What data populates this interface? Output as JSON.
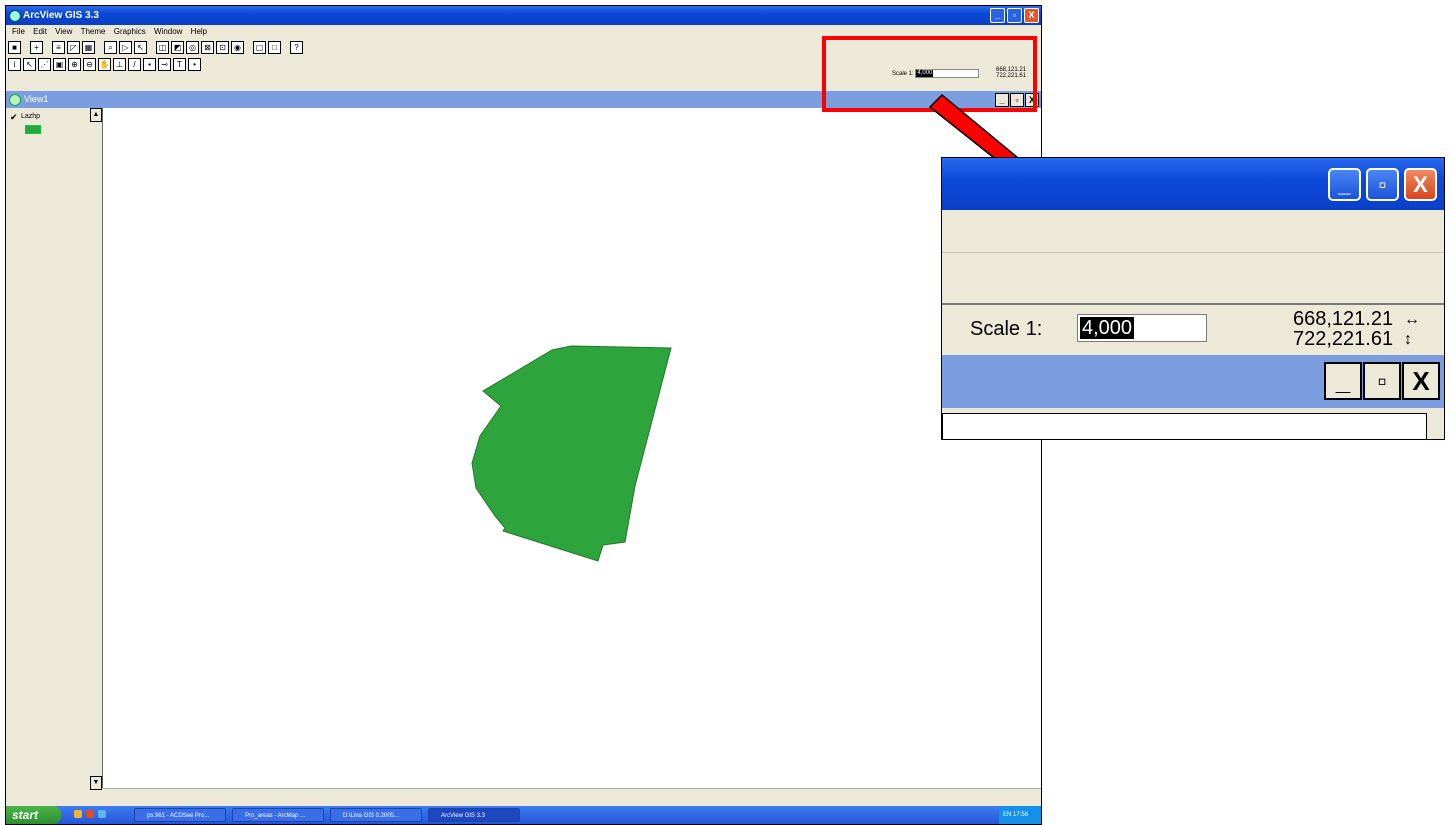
{
  "window": {
    "title": "ArcView GIS 3.3",
    "controls": [
      "_",
      "▫",
      "X"
    ]
  },
  "menu": [
    "File",
    "Edit",
    "View",
    "Theme",
    "Graphics",
    "Window",
    "Help"
  ],
  "view": {
    "title": "View1",
    "controls": [
      "_",
      "▫",
      "X"
    ]
  },
  "toc": {
    "layer_name": "Lazhp",
    "layer_color": "#2ea43c",
    "checked": true
  },
  "scale": {
    "label": "Scale 1:",
    "value": "4,000"
  },
  "coords": {
    "x": "668,121.21",
    "y": "722,221.61",
    "x_arrow": "↔",
    "y_arrow": "↕"
  },
  "taskbar": {
    "start_label": "start",
    "tasks": [
      "ps.961 - ACDSee Pro...",
      "Pro_areas - ArcMap ...",
      "D:\\Lina GIS 0.2005...",
      "ArcView GIS 3.3"
    ],
    "tray_time": "17:56",
    "tray_lang": "EN"
  },
  "colors": {
    "titlebar": "#0a48d8",
    "viewbar": "#7b9ee0",
    "polygon": "#2ea43c",
    "highlight": "#ff0000"
  }
}
